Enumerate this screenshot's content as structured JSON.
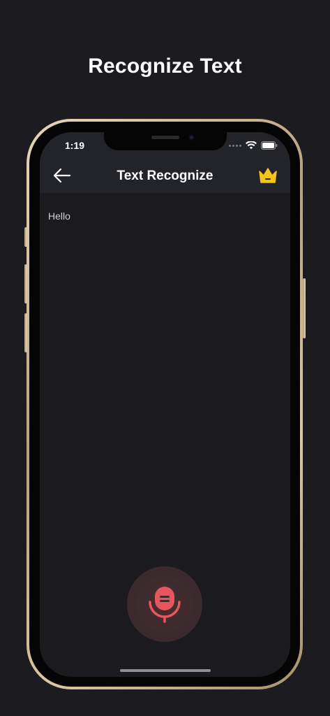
{
  "headline": "Recognize Text",
  "status_bar": {
    "time": "1:19",
    "icons": [
      "signal-dots-icon",
      "wifi-icon",
      "battery-icon"
    ]
  },
  "nav": {
    "back_icon": "arrow-left-icon",
    "title": "Text Recognize",
    "premium_icon": "crown-icon"
  },
  "content": {
    "recognized_text": "Hello"
  },
  "mic": {
    "icon": "microphone-icon"
  },
  "colors": {
    "background": "#1c1c20",
    "nav_bar": "#23242a",
    "accent_red": "#e5575d",
    "crown_yellow": "#f5c518",
    "mic_circle": "#3a2a2d"
  }
}
